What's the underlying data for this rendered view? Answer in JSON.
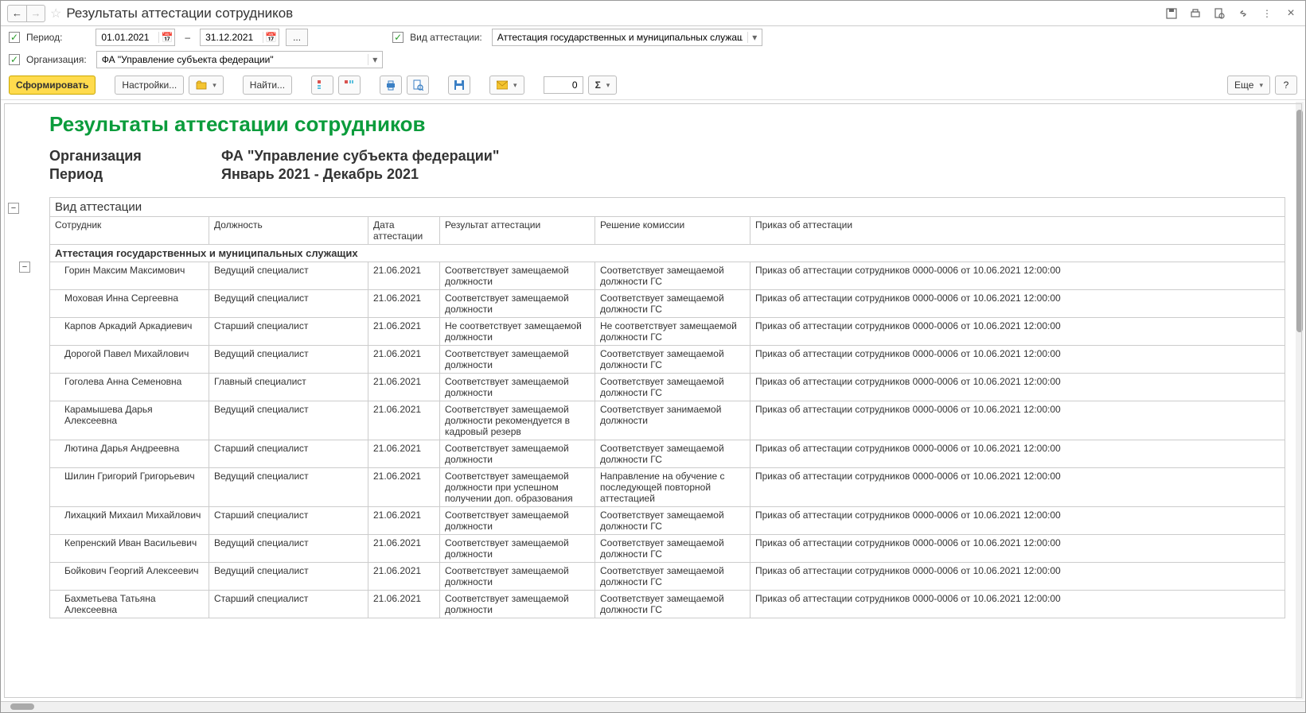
{
  "window": {
    "title": "Результаты аттестации сотрудников"
  },
  "filters": {
    "period_label": "Период:",
    "date_from": "01.01.2021",
    "date_to": "31.12.2021",
    "dash": "–",
    "ellipsis": "...",
    "att_kind_label": "Вид аттестации:",
    "att_kind_value": "Аттестация государственных и муниципальных служащих",
    "org_label": "Организация:",
    "org_value": "ФА \"Управление субъекта федерации\""
  },
  "toolbar": {
    "generate": "Сформировать",
    "settings": "Настройки...",
    "find": "Найти...",
    "num_value": "0",
    "sigma": "Σ",
    "more": "Еще",
    "help": "?"
  },
  "report": {
    "title": "Результаты аттестации сотрудников",
    "org_label": "Организация",
    "org_value": "ФА \"Управление субъекта федерации\"",
    "period_label": "Период",
    "period_value": "Январь 2021 - Декабрь 2021",
    "group_header": "Вид аттестации",
    "columns": {
      "employee": "Сотрудник",
      "position": "Должность",
      "date": "Дата аттестации",
      "result": "Результат аттестации",
      "decision": "Решение комиссии",
      "order": "Приказ об аттестации"
    },
    "section": "Аттестация государственных и муниципальных служащих",
    "rows": [
      {
        "employee": "Горин Максим Максимович",
        "position": "Ведущий специалист",
        "date": "21.06.2021",
        "result": "Соответствует замещаемой должности",
        "decision": "Соответствует замещаемой должности ГС",
        "order": "Приказ об аттестации сотрудников 0000-0006 от 10.06.2021 12:00:00"
      },
      {
        "employee": "Моховая Инна Сергеевна",
        "position": "Ведущий специалист",
        "date": "21.06.2021",
        "result": "Соответствует замещаемой должности",
        "decision": "Соответствует замещаемой должности ГС",
        "order": "Приказ об аттестации сотрудников 0000-0006 от 10.06.2021 12:00:00"
      },
      {
        "employee": "Карпов Аркадий Аркадиевич",
        "position": "Старший специалист",
        "date": "21.06.2021",
        "result": "Не соответствует замещаемой должности",
        "decision": "Не соответствует замещаемой должности ГС",
        "order": "Приказ об аттестации сотрудников 0000-0006 от 10.06.2021 12:00:00"
      },
      {
        "employee": "Дорогой Павел Михайлович",
        "position": "Ведущий специалист",
        "date": "21.06.2021",
        "result": "Соответствует замещаемой должности",
        "decision": "Соответствует замещаемой должности ГС",
        "order": "Приказ об аттестации сотрудников 0000-0006 от 10.06.2021 12:00:00"
      },
      {
        "employee": "Гоголева Анна Семеновна",
        "position": "Главный специалист",
        "date": "21.06.2021",
        "result": "Соответствует замещаемой должности",
        "decision": "Соответствует замещаемой должности ГС",
        "order": "Приказ об аттестации сотрудников 0000-0006 от 10.06.2021 12:00:00"
      },
      {
        "employee": "Карамышева Дарья Алексеевна",
        "position": "Ведущий специалист",
        "date": "21.06.2021",
        "result": "Соответствует замещаемой должности рекомендуется в кадровый резерв",
        "decision": "Соответствует занимаемой должности",
        "order": "Приказ об аттестации сотрудников 0000-0006 от 10.06.2021 12:00:00"
      },
      {
        "employee": "Лютина Дарья Андреевна",
        "position": "Старший специалист",
        "date": "21.06.2021",
        "result": "Соответствует замещаемой должности",
        "decision": "Соответствует замещаемой должности ГС",
        "order": "Приказ об аттестации сотрудников 0000-0006 от 10.06.2021 12:00:00"
      },
      {
        "employee": "Шилин Григорий Григорьевич",
        "position": "Ведущий специалист",
        "date": "21.06.2021",
        "result": "Соответствует замещаемой должности при успешном получении доп. образования",
        "decision": "Направление на обучение с последующей повторной аттестацией",
        "order": "Приказ об аттестации сотрудников 0000-0006 от 10.06.2021 12:00:00"
      },
      {
        "employee": "Лихацкий Михаил Михайлович",
        "position": "Старший специалист",
        "date": "21.06.2021",
        "result": "Соответствует замещаемой должности",
        "decision": "Соответствует замещаемой должности ГС",
        "order": "Приказ об аттестации сотрудников 0000-0006 от 10.06.2021 12:00:00"
      },
      {
        "employee": "Кепренский Иван Васильевич",
        "position": "Ведущий специалист",
        "date": "21.06.2021",
        "result": "Соответствует замещаемой должности",
        "decision": "Соответствует замещаемой должности ГС",
        "order": "Приказ об аттестации сотрудников 0000-0006 от 10.06.2021 12:00:00"
      },
      {
        "employee": "Бойкович Георгий Алексеевич",
        "position": "Ведущий специалист",
        "date": "21.06.2021",
        "result": "Соответствует замещаемой должности",
        "decision": "Соответствует замещаемой должности ГС",
        "order": "Приказ об аттестации сотрудников 0000-0006 от 10.06.2021 12:00:00"
      },
      {
        "employee": "Бахметьева Татьяна Алексеевна",
        "position": "Старший специалист",
        "date": "21.06.2021",
        "result": "Соответствует замещаемой должности",
        "decision": "Соответствует замещаемой должности ГС",
        "order": "Приказ об аттестации сотрудников 0000-0006 от 10.06.2021 12:00:00"
      }
    ]
  }
}
